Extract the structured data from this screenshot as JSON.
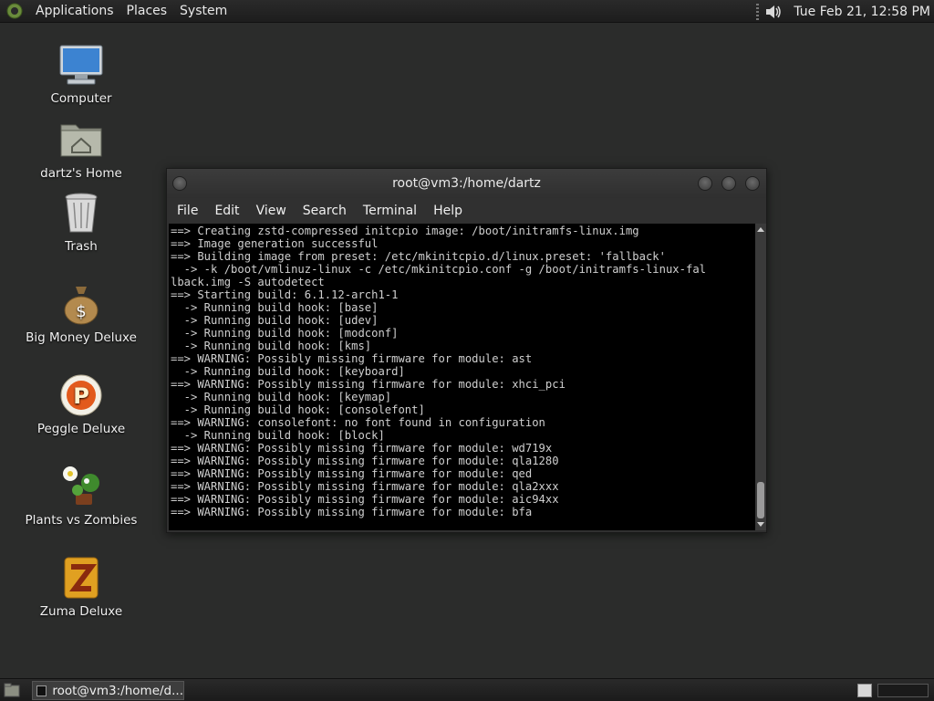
{
  "top_panel": {
    "menus": [
      "Applications",
      "Places",
      "System"
    ],
    "clock": "Tue Feb 21, 12:58 PM",
    "icons": {
      "logo": "mate-logo-icon",
      "volume": "speaker-icon"
    }
  },
  "desktop_icons": [
    {
      "label": "Computer",
      "icon": "computer-icon"
    },
    {
      "label": "dartz's Home",
      "icon": "home-folder-icon"
    },
    {
      "label": "Trash",
      "icon": "trash-icon"
    },
    {
      "label": "Big Money Deluxe",
      "icon": "money-bag-icon"
    },
    {
      "label": "Peggle Deluxe",
      "icon": "peggle-icon"
    },
    {
      "label": "Plants vs Zombies",
      "icon": "plants-icon"
    },
    {
      "label": "Zuma Deluxe",
      "icon": "zuma-icon"
    }
  ],
  "terminal": {
    "title": "root@vm3:/home/dartz",
    "menu": [
      "File",
      "Edit",
      "View",
      "Search",
      "Terminal",
      "Help"
    ],
    "lines": [
      "==> Creating zstd-compressed initcpio image: /boot/initramfs-linux.img",
      "==> Image generation successful",
      "==> Building image from preset: /etc/mkinitcpio.d/linux.preset: 'fallback'",
      "  -> -k /boot/vmlinuz-linux -c /etc/mkinitcpio.conf -g /boot/initramfs-linux-fal",
      "lback.img -S autodetect",
      "==> Starting build: 6.1.12-arch1-1",
      "  -> Running build hook: [base]",
      "  -> Running build hook: [udev]",
      "  -> Running build hook: [modconf]",
      "  -> Running build hook: [kms]",
      "==> WARNING: Possibly missing firmware for module: ast",
      "  -> Running build hook: [keyboard]",
      "==> WARNING: Possibly missing firmware for module: xhci_pci",
      "  -> Running build hook: [keymap]",
      "  -> Running build hook: [consolefont]",
      "==> WARNING: consolefont: no font found in configuration",
      "  -> Running build hook: [block]",
      "==> WARNING: Possibly missing firmware for module: wd719x",
      "==> WARNING: Possibly missing firmware for module: qla1280",
      "==> WARNING: Possibly missing firmware for module: qed",
      "==> WARNING: Possibly missing firmware for module: qla2xxx",
      "==> WARNING: Possibly missing firmware for module: aic94xx",
      "==> WARNING: Possibly missing firmware for module: bfa"
    ]
  },
  "bottom_panel": {
    "task_label": "root@vm3:/home/d..."
  }
}
